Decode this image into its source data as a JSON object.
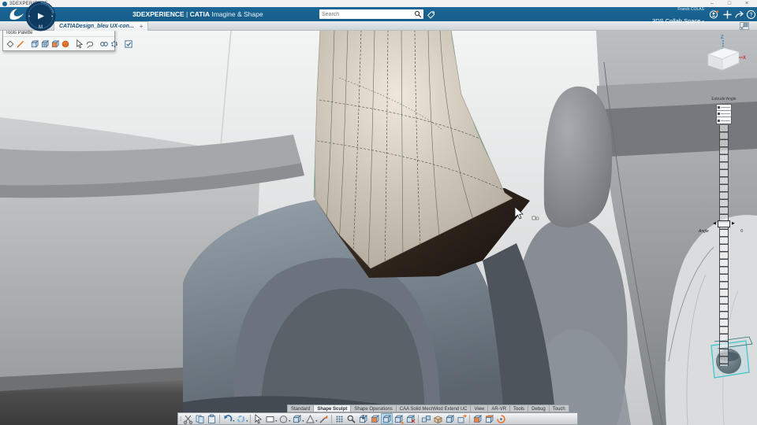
{
  "os_bar": {
    "title": "3DEXPERIENCE",
    "minimize": "–",
    "maximize": "□",
    "close": "×"
  },
  "header": {
    "brand": "3DEXPERIENCE",
    "separator": "|",
    "app": "CATIA",
    "edition": "Imagine & Shape",
    "search_placeholder": "Search",
    "user_name": "Franck COLAS",
    "collab_space": "3DS Collab Space",
    "collab_caret": "▾",
    "compass_letter": "M",
    "bar_color": "#155d8b"
  },
  "tab_bar": {
    "active_tab": "CATIADesign_bleu UX-con...",
    "new_tab": "+"
  },
  "tool_palette": {
    "title": "Tools Palette",
    "tools": [
      {
        "name": "select-tool",
        "icon": "diamond"
      },
      {
        "name": "sketch-curve-tool",
        "icon": "pen"
      },
      {
        "name": "divider"
      },
      {
        "name": "modify-cage-tool",
        "icon": "cube"
      },
      {
        "name": "subdivide-cage-tool",
        "icon": "cube-grid"
      },
      {
        "name": "extrude-face-tool",
        "icon": "cube-orange-face"
      },
      {
        "name": "sphere-primitive-tool",
        "icon": "sphere-orange"
      },
      {
        "name": "divider"
      },
      {
        "name": "translation-tool",
        "icon": "pointer"
      },
      {
        "name": "lasso-select-tool",
        "icon": "lasso"
      },
      {
        "name": "divider"
      },
      {
        "name": "link-tool",
        "icon": "chain"
      },
      {
        "name": "refresh-tool",
        "icon": "gear"
      },
      {
        "name": "divider"
      },
      {
        "name": "validate-checkbox",
        "icon": "checkbox"
      }
    ]
  },
  "viewport": {
    "view_cube": {
      "axis_up": "Z",
      "axis_right": "X"
    },
    "extrude_widget": {
      "title": "Extrude Angle",
      "angle_label": "Angle",
      "angle_value": "0",
      "arrow_left": "◀",
      "arrow_right": "▶"
    }
  },
  "workbench": {
    "tabs": [
      {
        "label": "Standard",
        "active": false
      },
      {
        "label": "Shape Sculpt",
        "active": true
      },
      {
        "label": "Shape Operations",
        "active": false
      },
      {
        "label": "CAA Solid MechMod Extend UC",
        "active": false
      },
      {
        "label": "View",
        "active": false
      },
      {
        "label": "AR-VR",
        "active": false
      },
      {
        "label": "Tools",
        "active": false
      },
      {
        "label": "Debug",
        "active": false
      },
      {
        "label": "Touch",
        "active": false
      }
    ]
  },
  "action_bar": {
    "grip": "⁞",
    "tools": [
      {
        "name": "cut",
        "icon": "scissors"
      },
      {
        "name": "copy",
        "icon": "copy"
      },
      {
        "name": "paste",
        "icon": "paste"
      },
      {
        "name": "divider"
      },
      {
        "name": "undo",
        "icon": "undo",
        "dropdown": true
      },
      {
        "name": "update",
        "icon": "update",
        "dropdown": true
      },
      {
        "name": "divider"
      },
      {
        "name": "select-sketch",
        "icon": "pointer"
      },
      {
        "name": "rectangle-primitive",
        "icon": "rect",
        "dropdown": true
      },
      {
        "name": "sphere-primitive",
        "icon": "sphere-gray",
        "dropdown": true
      },
      {
        "name": "box-primitive",
        "icon": "cube",
        "dropdown": true
      },
      {
        "name": "pyramid-primitive",
        "icon": "pyramid",
        "dropdown": true
      },
      {
        "name": "knife-tool",
        "icon": "knife"
      },
      {
        "name": "divider"
      },
      {
        "name": "pattern-grid",
        "icon": "grid"
      },
      {
        "name": "zoom-analysis",
        "icon": "zoom"
      },
      {
        "name": "import-mesh",
        "icon": "arrow-cube"
      },
      {
        "name": "modify-face",
        "icon": "cube-orange-face"
      },
      {
        "name": "active-subdivision",
        "icon": "cube",
        "active": true
      },
      {
        "name": "extrude-cage",
        "icon": "cube-arrow"
      },
      {
        "name": "delete-face",
        "icon": "cube-x"
      },
      {
        "name": "divider"
      },
      {
        "name": "align-cages",
        "icon": "cubes"
      },
      {
        "name": "open-box",
        "icon": "open-box"
      },
      {
        "name": "close-box",
        "icon": "cube"
      },
      {
        "name": "export-box",
        "icon": "box-arrow"
      },
      {
        "name": "divider"
      },
      {
        "name": "weld-faces",
        "icon": "cube-orange-face"
      },
      {
        "name": "cap-face",
        "icon": "cap"
      },
      {
        "name": "smooth-swirl",
        "icon": "swirl"
      }
    ]
  },
  "colors": {
    "accent_orange": "#e8762d",
    "accent_blue": "#3e678a",
    "selection_teal": "#3cc4ca"
  }
}
